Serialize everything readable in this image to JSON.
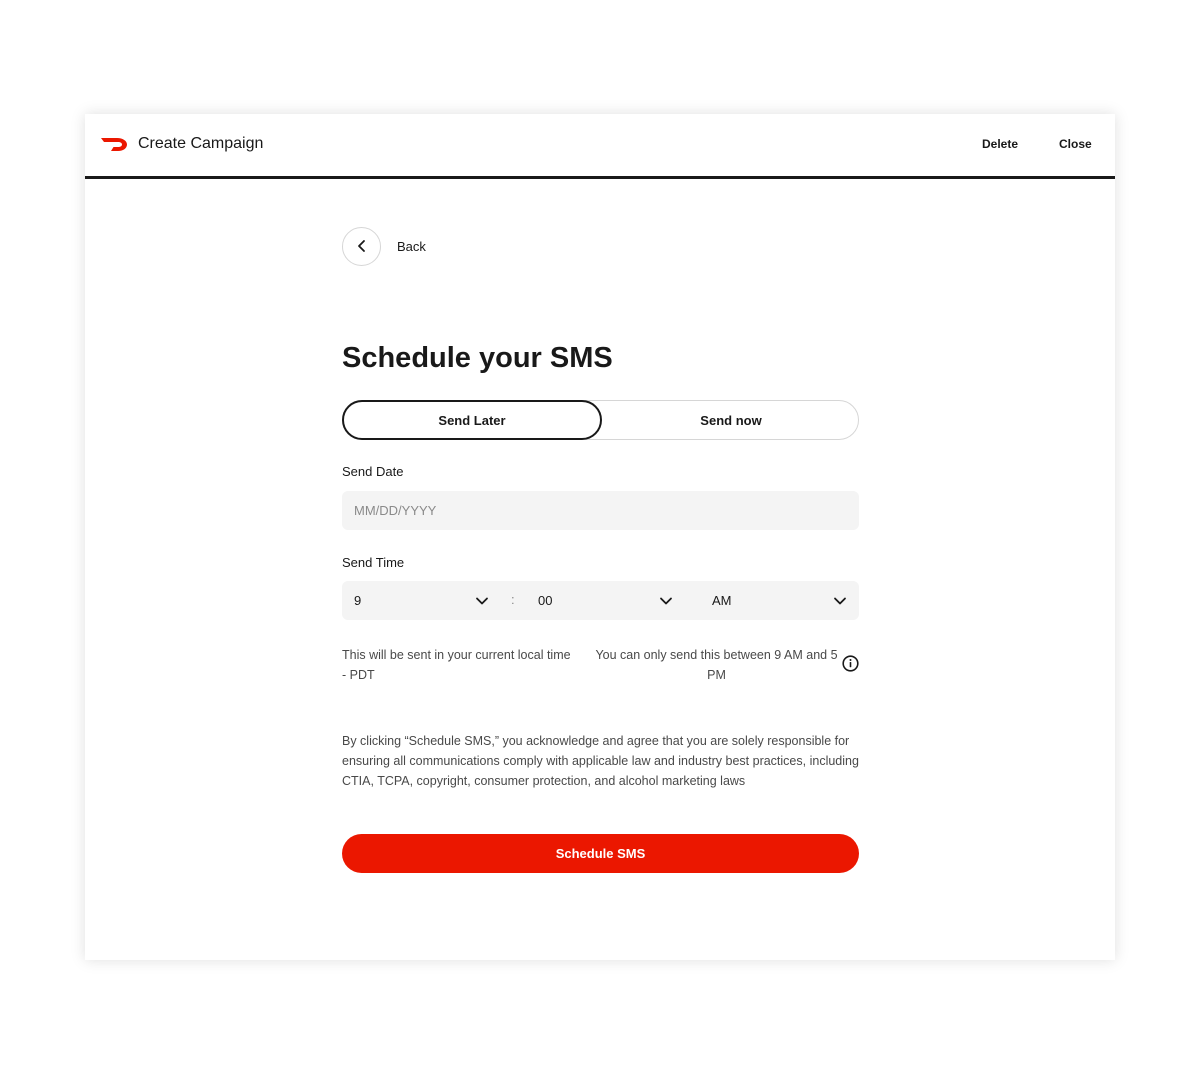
{
  "header": {
    "title": "Create Campaign",
    "delete_label": "Delete",
    "close_label": "Close",
    "brand_color": "#EB1700"
  },
  "back": {
    "label": "Back"
  },
  "page": {
    "title": "Schedule your SMS"
  },
  "schedule_mode": {
    "options": [
      "Send Later",
      "Send now"
    ],
    "selected": "Send Later"
  },
  "send_date": {
    "label": "Send Date",
    "value": "",
    "placeholder": "MM/DD/YYYY"
  },
  "send_time": {
    "label": "Send Time",
    "hour": "9",
    "separator": ":",
    "minute": "00",
    "period": "AM"
  },
  "help": {
    "timezone_note": "This will be sent in your current local time - PDT",
    "window_note": "You can only send this between 9 AM and 5 PM"
  },
  "legal_text": "By clicking “Schedule SMS,” you acknowledge and agree that you are solely responsible for ensuring all communications comply with applicable law and industry best practices, including CTIA, TCPA, copyright, consumer protection, and alcohol marketing laws",
  "submit": {
    "label": "Schedule SMS",
    "color": "#EB1700"
  },
  "icons": {
    "logo": "doordash-logo-icon",
    "back": "chevron-left-icon",
    "dropdown": "chevron-down-icon",
    "info": "info-icon"
  }
}
